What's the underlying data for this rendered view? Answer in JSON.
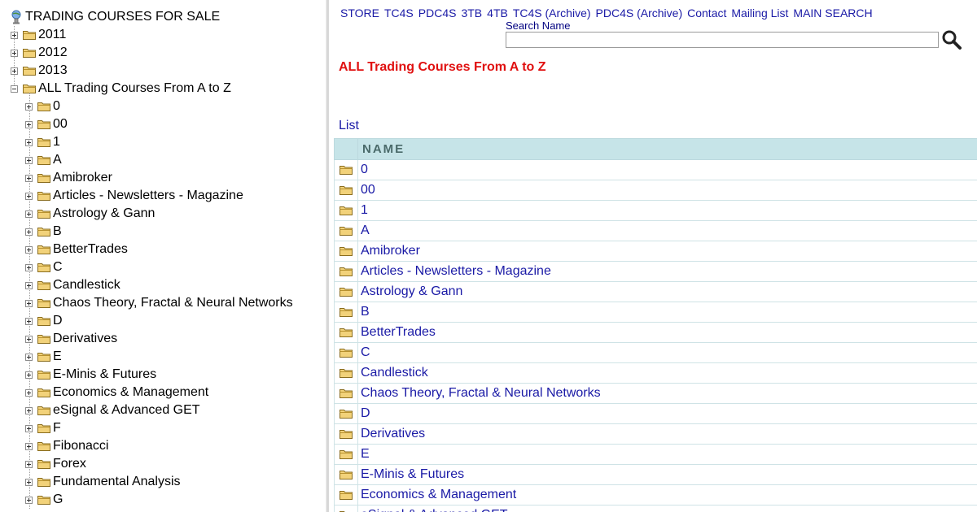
{
  "tree": {
    "root_label": "TRADING COURSES FOR SALE",
    "years": [
      {
        "label": "2011"
      },
      {
        "label": "2012"
      },
      {
        "label": "2013"
      }
    ],
    "all_courses": {
      "label": "ALL Trading Courses From A to Z",
      "children": [
        {
          "label": "0"
        },
        {
          "label": "00"
        },
        {
          "label": "1"
        },
        {
          "label": "A"
        },
        {
          "label": "Amibroker"
        },
        {
          "label": "Articles - Newsletters - Magazine"
        },
        {
          "label": "Astrology & Gann"
        },
        {
          "label": "B"
        },
        {
          "label": "BetterTrades"
        },
        {
          "label": "C"
        },
        {
          "label": "Candlestick"
        },
        {
          "label": "Chaos Theory, Fractal & Neural Networks"
        },
        {
          "label": "D"
        },
        {
          "label": "Derivatives"
        },
        {
          "label": "E"
        },
        {
          "label": "E-Minis & Futures"
        },
        {
          "label": "Economics & Management"
        },
        {
          "label": "eSignal & Advanced GET"
        },
        {
          "label": "F"
        },
        {
          "label": "Fibonacci"
        },
        {
          "label": "Forex"
        },
        {
          "label": "Fundamental Analysis"
        },
        {
          "label": "G"
        }
      ]
    }
  },
  "topnav": [
    {
      "label": "STORE"
    },
    {
      "label": "TC4S"
    },
    {
      "label": "PDC4S"
    },
    {
      "label": "3TB"
    },
    {
      "label": "4TB"
    },
    {
      "label": "TC4S (Archive)"
    },
    {
      "label": "PDC4S (Archive)"
    },
    {
      "label": "Contact"
    },
    {
      "label": "Mailing List"
    },
    {
      "label": "MAIN SEARCH"
    }
  ],
  "search": {
    "label": "Search Name",
    "value": ""
  },
  "heading": "ALL Trading Courses From A to Z",
  "list_link": "List",
  "table": {
    "header": "NAME",
    "rows": [
      {
        "name": "0"
      },
      {
        "name": "00"
      },
      {
        "name": "1"
      },
      {
        "name": "A"
      },
      {
        "name": "Amibroker"
      },
      {
        "name": "Articles - Newsletters - Magazine"
      },
      {
        "name": "Astrology & Gann"
      },
      {
        "name": "B"
      },
      {
        "name": "BetterTrades"
      },
      {
        "name": "C"
      },
      {
        "name": "Candlestick"
      },
      {
        "name": "Chaos Theory, Fractal & Neural Networks"
      },
      {
        "name": "D"
      },
      {
        "name": "Derivatives"
      },
      {
        "name": "E"
      },
      {
        "name": "E-Minis & Futures"
      },
      {
        "name": "Economics & Management"
      },
      {
        "name": "eSignal & Advanced GET"
      }
    ]
  },
  "colors": {
    "link": "#1a1aa6",
    "heading": "#e01010",
    "table_header_bg": "#c6e4e8",
    "folder": "#f2d27a"
  }
}
